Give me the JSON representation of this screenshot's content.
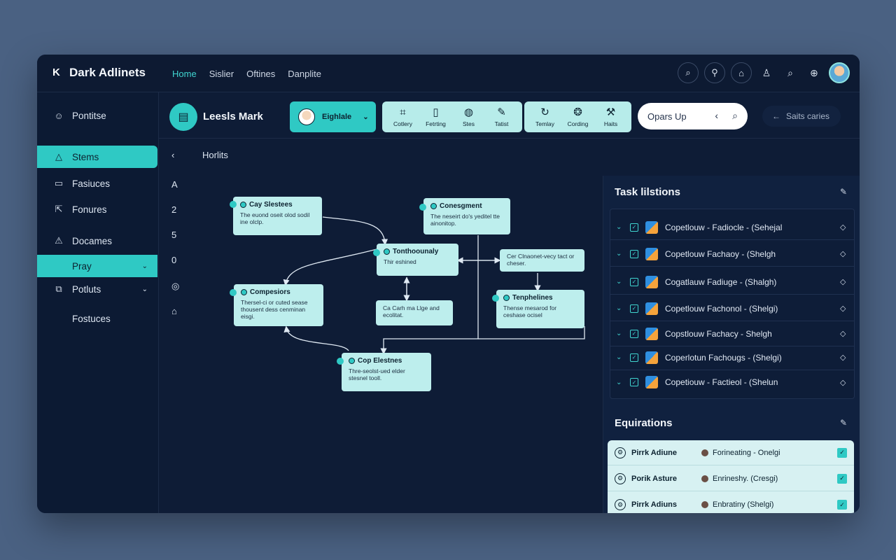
{
  "app": {
    "title": "Dark Adlinets",
    "logo_glyph": "K"
  },
  "nav": [
    {
      "label": "Home",
      "active": true
    },
    {
      "label": "Sislier",
      "active": false
    },
    {
      "label": "Oftines",
      "active": false
    },
    {
      "label": "Danplite",
      "active": false
    }
  ],
  "sidebar": {
    "items": [
      {
        "label": "Pontitse",
        "icon": "smiley-icon"
      },
      {
        "label": "Stems",
        "icon": "warning-icon",
        "active": true
      },
      {
        "label": "Fasiuces",
        "icon": "monitor-icon"
      },
      {
        "label": "Fonures",
        "icon": "share-icon"
      },
      {
        "label": "Docames",
        "icon": "alert-icon"
      },
      {
        "label": "Pray",
        "icon": "",
        "sub": true
      },
      {
        "label": "Potluts",
        "icon": "gallery-icon"
      },
      {
        "label": "Fostuces",
        "icon": ""
      }
    ]
  },
  "toolbar": {
    "profile_name": "Leesls Mark",
    "dropdown_label": "Eighlale",
    "group1": [
      {
        "label": "Cotlery",
        "icon": "chart-icon"
      },
      {
        "label": "Fetrting",
        "icon": "doc-icon"
      },
      {
        "label": "Stes",
        "icon": "globe-icon"
      },
      {
        "label": "Tatist",
        "icon": "pen-icon"
      }
    ],
    "group2": [
      {
        "label": "Temlay",
        "icon": "refresh-icon"
      },
      {
        "label": "Cording",
        "icon": "brain-icon"
      },
      {
        "label": "Haits",
        "icon": "tools-icon"
      }
    ],
    "search_value": "Opars Up",
    "settings_label": "Saits caries"
  },
  "subnav": [
    "‹",
    "A",
    "2",
    "5",
    "0",
    "◎",
    "⌂"
  ],
  "diagram": {
    "heading": "Horlits",
    "nodes": [
      {
        "title": "Cay Slestees",
        "body": "The euond oseit olod sodil ine olclp."
      },
      {
        "title": "Conesgment",
        "body": "The neseirt do's yeditel tte ainonitop."
      },
      {
        "title": "Tonthoounaly",
        "body": "Thir eshined"
      },
      {
        "title": "",
        "body": "Cer Clnaonet-vecy tact or cheser."
      },
      {
        "title": "Compesiors",
        "body": "Thersel-ci or cuted sease thousent dess cenminan eisgi."
      },
      {
        "title": "",
        "body": "Ca Carh ma Llge and ecolitat."
      },
      {
        "title": "Tenphelines",
        "body": "Thense mesarod for ceshase ocisel"
      },
      {
        "title": "Cop Elestnes",
        "body": "Thre-seolst-ued elder stesnel tooll."
      }
    ]
  },
  "tasks": {
    "title": "Task lilstions",
    "rows": [
      "Copetlouw - Fadiocle - (Sehejal",
      "Copetlouw  Fachaoy - (Shelgh",
      "Cogatlauw  Fadiuge - (Shalgh)",
      "Copetlouw  Fachonol - (Shelgi)",
      "Copstlouw  Fachacy - Shelgh",
      "Coperlotun  Fachougs - (Shelgi)",
      "Copetiouw - Factieol - (Shelun"
    ]
  },
  "equirations": {
    "title": "Equirations",
    "rows": [
      {
        "name": "Pirrk Adiune",
        "value": "Forineating - Onelgi"
      },
      {
        "name": "Porik Asture",
        "value": "Enrineshy. (Cresgi)"
      },
      {
        "name": "Pirrk Adiuns",
        "value": "Enbratiny (Shelgi)"
      }
    ]
  }
}
